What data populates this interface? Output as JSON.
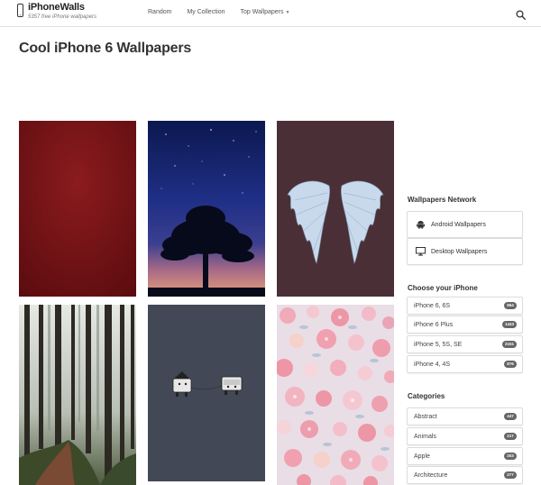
{
  "header": {
    "site_title": "iPhoneWalls",
    "site_subtitle": "5357 free iPhone wallpapers",
    "nav": [
      {
        "label": "Random"
      },
      {
        "label": "My Collection"
      },
      {
        "label": "Top Wallpapers"
      }
    ],
    "dropdown_caret": "▼"
  },
  "page": {
    "title": "Cool iPhone 6 Wallpapers"
  },
  "icons": {
    "logo": "phone-icon",
    "search": "search-icon",
    "android": "android-icon",
    "desktop": "monitor-icon"
  },
  "sidebar": {
    "network": {
      "title": "Wallpapers Network",
      "items": [
        {
          "label": "Android Wallpapers"
        },
        {
          "label": "Desktop Wallpapers"
        }
      ]
    },
    "choose": {
      "title": "Choose your iPhone",
      "items": [
        {
          "label": "iPhone 6, 6S",
          "count": "854"
        },
        {
          "label": "iPhone 6 Plus",
          "count": "1443"
        },
        {
          "label": "iPhone 5, 5S, SE",
          "count": "2151"
        },
        {
          "label": "iPhone 4, 4S",
          "count": "876"
        }
      ]
    },
    "categories": {
      "title": "Categories",
      "items": [
        {
          "label": "Abstract",
          "count": "447"
        },
        {
          "label": "Animals",
          "count": "217"
        },
        {
          "label": "Apple",
          "count": "203"
        },
        {
          "label": "Architecture",
          "count": "277"
        }
      ]
    }
  },
  "colors": {
    "badge": "#666666",
    "border": "#dcdcdc",
    "text": "#333333"
  }
}
